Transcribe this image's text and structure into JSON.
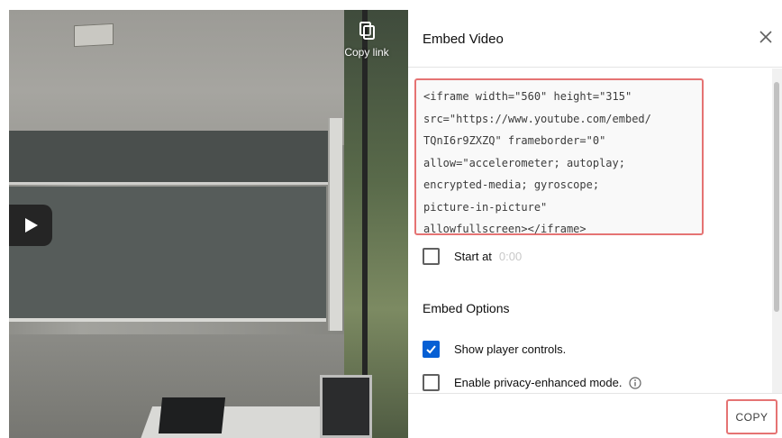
{
  "video": {
    "copy_link_label": "Copy link",
    "icons": {
      "copy": "copy-icon",
      "play": "play-icon"
    }
  },
  "dialog": {
    "title": "Embed Video",
    "close_icon": "close-icon",
    "embed_code": "<iframe width=\"560\" height=\"315\"\nsrc=\"https://www.youtube.com/embed/\nTQnI6r9ZXZQ\" frameborder=\"0\"\nallow=\"accelerometer; autoplay;\nencrypted-media; gyroscope;\npicture-in-picture\"\nallowfullscreen></iframe>",
    "start_at": {
      "label": "Start at",
      "time": "0:00",
      "checked": false
    },
    "embed_options_title": "Embed Options",
    "options": [
      {
        "label": "Show player controls.",
        "checked": true
      },
      {
        "label": "Enable privacy-enhanced mode.",
        "checked": false,
        "info_icon": "info-icon"
      }
    ],
    "copy_button": "COPY"
  },
  "colors": {
    "accent": "#065fd4",
    "highlight_border": "#e57373"
  }
}
